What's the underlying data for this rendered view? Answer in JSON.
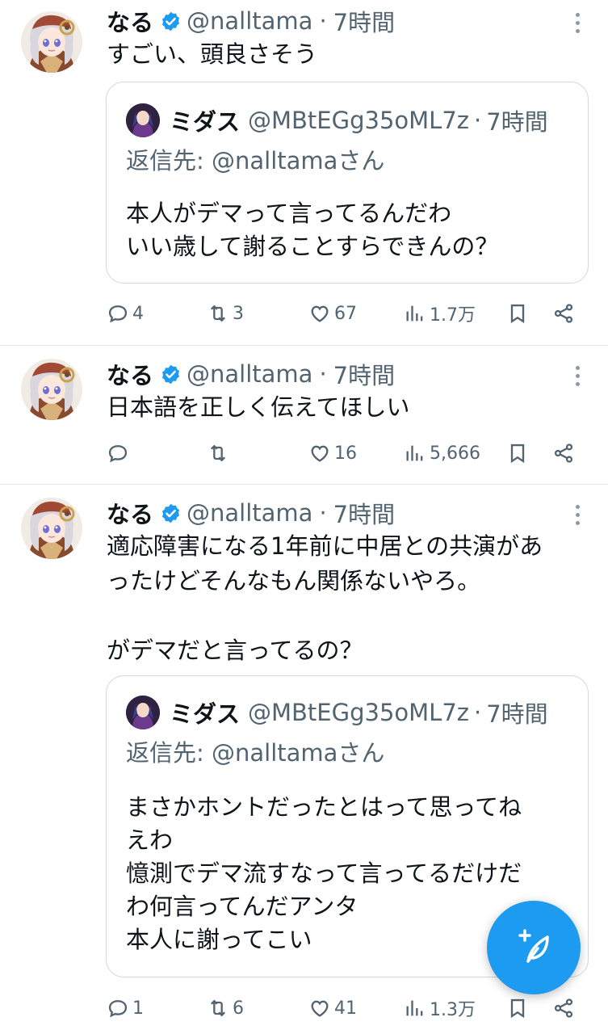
{
  "tweets": [
    {
      "name": "なる",
      "handle": "@nalltama",
      "sep": "·",
      "time": "7時間",
      "text": "すごい、頭良さそう",
      "quote": {
        "name": "ミダス",
        "handle": "@MBtEGg35oML7z",
        "sep": "·",
        "time": "7時間",
        "reply_to": "返信先: @nalltamaさん",
        "text": "本人がデマって言ってるんだわ\nいい歳して謝ることすらできんの？"
      },
      "stats": {
        "replies": "4",
        "retweets": "3",
        "likes": "67",
        "views": "1.7万"
      }
    },
    {
      "name": "なる",
      "handle": "@nalltama",
      "sep": "·",
      "time": "7時間",
      "text": "日本語を正しく伝えてほしい",
      "stats": {
        "replies": "",
        "retweets": "",
        "likes": "16",
        "views": "5,666"
      }
    },
    {
      "name": "なる",
      "handle": "@nalltama",
      "sep": "·",
      "time": "7時間",
      "text": "適応障害になる1年前に中居との共演があ\nったけどそんなもん関係ないやろ。\n\nがデマだと言ってるの？",
      "quote": {
        "name": "ミダス",
        "handle": "@MBtEGg35oML7z",
        "sep": "·",
        "time": "7時間",
        "reply_to": "返信先: @nalltamaさん",
        "text": "まさかホントだったとはって思ってね\nえわ\n憶測でデマ流すなって言ってるだけだ\nわ何言ってんだアンタ\n本人に謝ってこい"
      },
      "stats": {
        "replies": "1",
        "retweets": "6",
        "likes": "41",
        "views": "1.3万"
      }
    }
  ],
  "colors": {
    "accent": "#1d9bf0",
    "muted": "#536471",
    "text": "#0f1419",
    "border": "#cfd9de"
  },
  "icons": [
    "verified-badge-icon",
    "more-icon",
    "reply-icon",
    "retweet-icon",
    "like-icon",
    "views-icon",
    "bookmark-icon",
    "share-icon",
    "compose-icon"
  ]
}
